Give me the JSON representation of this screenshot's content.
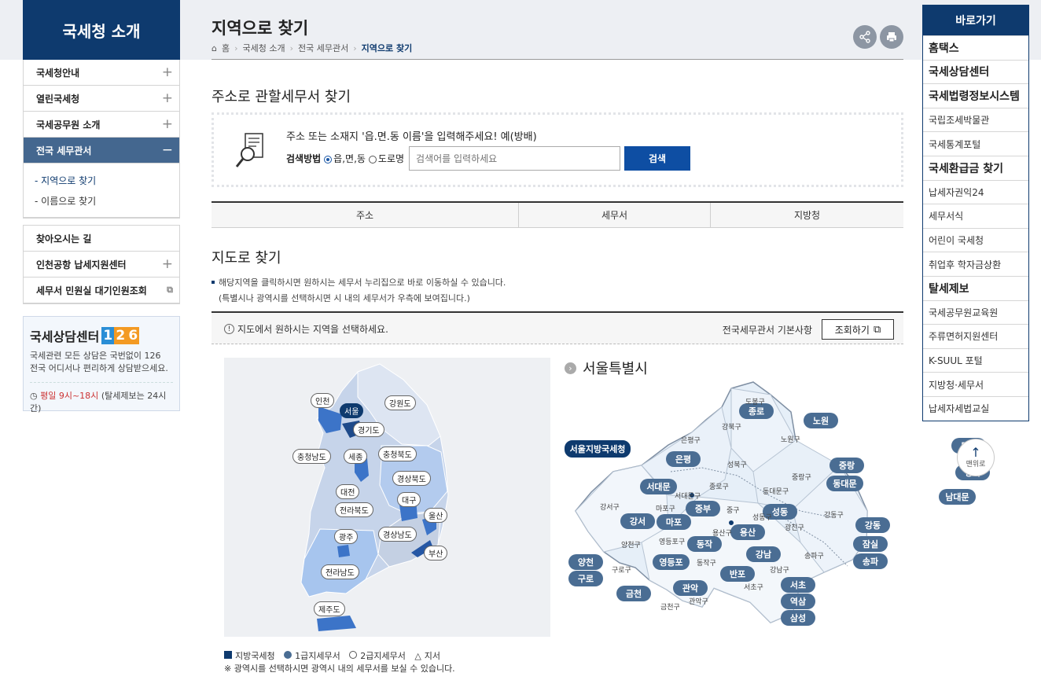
{
  "lnb": {
    "title": "국세청 소개",
    "items": [
      {
        "label": "국세청안내"
      },
      {
        "label": "열린국세청"
      },
      {
        "label": "국세공무원 소개"
      },
      {
        "label": "전국 세무관서"
      }
    ],
    "sub_items": [
      {
        "label": "지역으로 찾기"
      },
      {
        "label": "이름으로 찾기"
      }
    ],
    "items2": [
      {
        "label": "찾아오시는 길"
      },
      {
        "label": "인천공항 납세지원센터"
      },
      {
        "label": "세무서 민원실 대기인원조회"
      }
    ],
    "consult": {
      "title": "국세상담센터",
      "number": [
        "1",
        "2",
        "6"
      ],
      "desc1": "국세관련 모든 상담은 국번없이 126",
      "desc2": "전국 어디서나 편리하게 상담받으세요.",
      "hours": "평일 9시~18시",
      "hours_note": "(탈세제보는 24시간)"
    }
  },
  "page": {
    "title": "지역으로 찾기",
    "breadcrumb": [
      "홈",
      "국세청 소개",
      "전국 세무관서",
      "지역으로 찾기"
    ]
  },
  "search": {
    "heading": "주소로 관할세무서 찾기",
    "message": "주소 또는 소재지 '읍.면.동 이름'을 입력해주세요! 예(방배)",
    "method_label": "검색방법",
    "option1": "읍,면,동",
    "option2": "도로명",
    "placeholder": "검색어를 입력하세요",
    "button": "검색"
  },
  "tabs": [
    "주소",
    "세무서",
    "지방청"
  ],
  "map_section": {
    "heading": "지도로 찾기",
    "note1": "해당지역을 클릭하시면 원하시는 세무서 누리집으로 바로 이동하실 수 있습니다.",
    "note2": "(특별시나 광역시를 선택하시면 시 내의 세무서가 우측에 보여집니다.)",
    "guide": "지도에서 원하시는 지역을 선택하세요.",
    "basic_info": "전국세무관서 기본사항",
    "view_button": "조회하기"
  },
  "korea_map": {
    "regions": [
      "인천",
      "서울",
      "강원도",
      "경기도",
      "충청남도",
      "세종",
      "충청북도",
      "경상북도",
      "대전",
      "대구",
      "전라북도",
      "울산",
      "광주",
      "경상남도",
      "부산",
      "전라남도",
      "제주도"
    ]
  },
  "seoul_map": {
    "title": "서울특별시",
    "hq": "서울지방국세청",
    "offices": [
      "종로",
      "노원",
      "도봉",
      "은평",
      "성북",
      "중랑",
      "서대문",
      "동대문",
      "남대문",
      "중부",
      "성동",
      "강동",
      "마포",
      "강서",
      "용산",
      "잠실",
      "동작",
      "송파",
      "강남",
      "양천",
      "영등포",
      "반포",
      "구로",
      "서초",
      "금천",
      "관악",
      "역삼",
      "삼성"
    ],
    "districts": [
      "도봉구",
      "강북구",
      "노원구",
      "은평구",
      "성북구",
      "중랑구",
      "종로구",
      "서대문구",
      "동대문구",
      "강서구",
      "마포구",
      "중구",
      "성동구",
      "강동구",
      "광진구",
      "양천구",
      "영등포구",
      "용산구",
      "송파구",
      "구로구",
      "동작구",
      "강남구",
      "서초구",
      "금천구",
      "관악구"
    ]
  },
  "legend": {
    "l1": "지방국세청",
    "l2": "1급지세무서",
    "l3": "2급지세무서",
    "l4": "지서",
    "note": "※ 광역시를 선택하시면 광역시 내의 세무서를 보실 수 있습니다."
  },
  "quick": {
    "title": "바로가기",
    "items": [
      "홈택스",
      "국세상담센터",
      "국세법령정보시스템",
      "국립조세박물관",
      "국세통계포털",
      "국세환급금 찾기",
      "납세자권익24",
      "세무서식",
      "어린이 국세청",
      "취업후 학자금상환",
      "탈세제보",
      "국세공무원교육원",
      "주류면허지원센터",
      "K-SUUL 포털",
      "지방청·세무서",
      "납세자세법교실"
    ]
  },
  "top_button": "맨위로",
  "colors": {
    "navy": "#0e3a6e",
    "selected_menu": "#44678f",
    "search_button": "#0e4ea3",
    "seoul_label": "#4a6d93"
  }
}
